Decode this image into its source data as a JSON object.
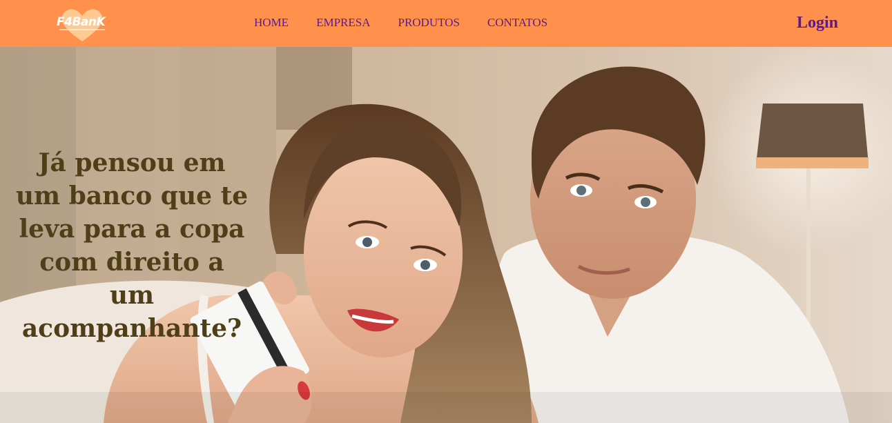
{
  "brand": {
    "logo_text": "F4BanK",
    "logo_icon": "heart-icon"
  },
  "nav": {
    "items": [
      {
        "label": "HOME"
      },
      {
        "label": "EMPRESA"
      },
      {
        "label": "PRODUTOS"
      },
      {
        "label": "CONTATOS"
      }
    ],
    "login_label": "Login"
  },
  "hero": {
    "headline": "Já pensou em um banco que te leva para a copa com direito a um acompanhante?",
    "image": "couple-with-credit-card-photo"
  },
  "colors": {
    "navbar": "#ff914d",
    "nav_text": "#5a1a8c",
    "headline": "#4e3f18"
  }
}
